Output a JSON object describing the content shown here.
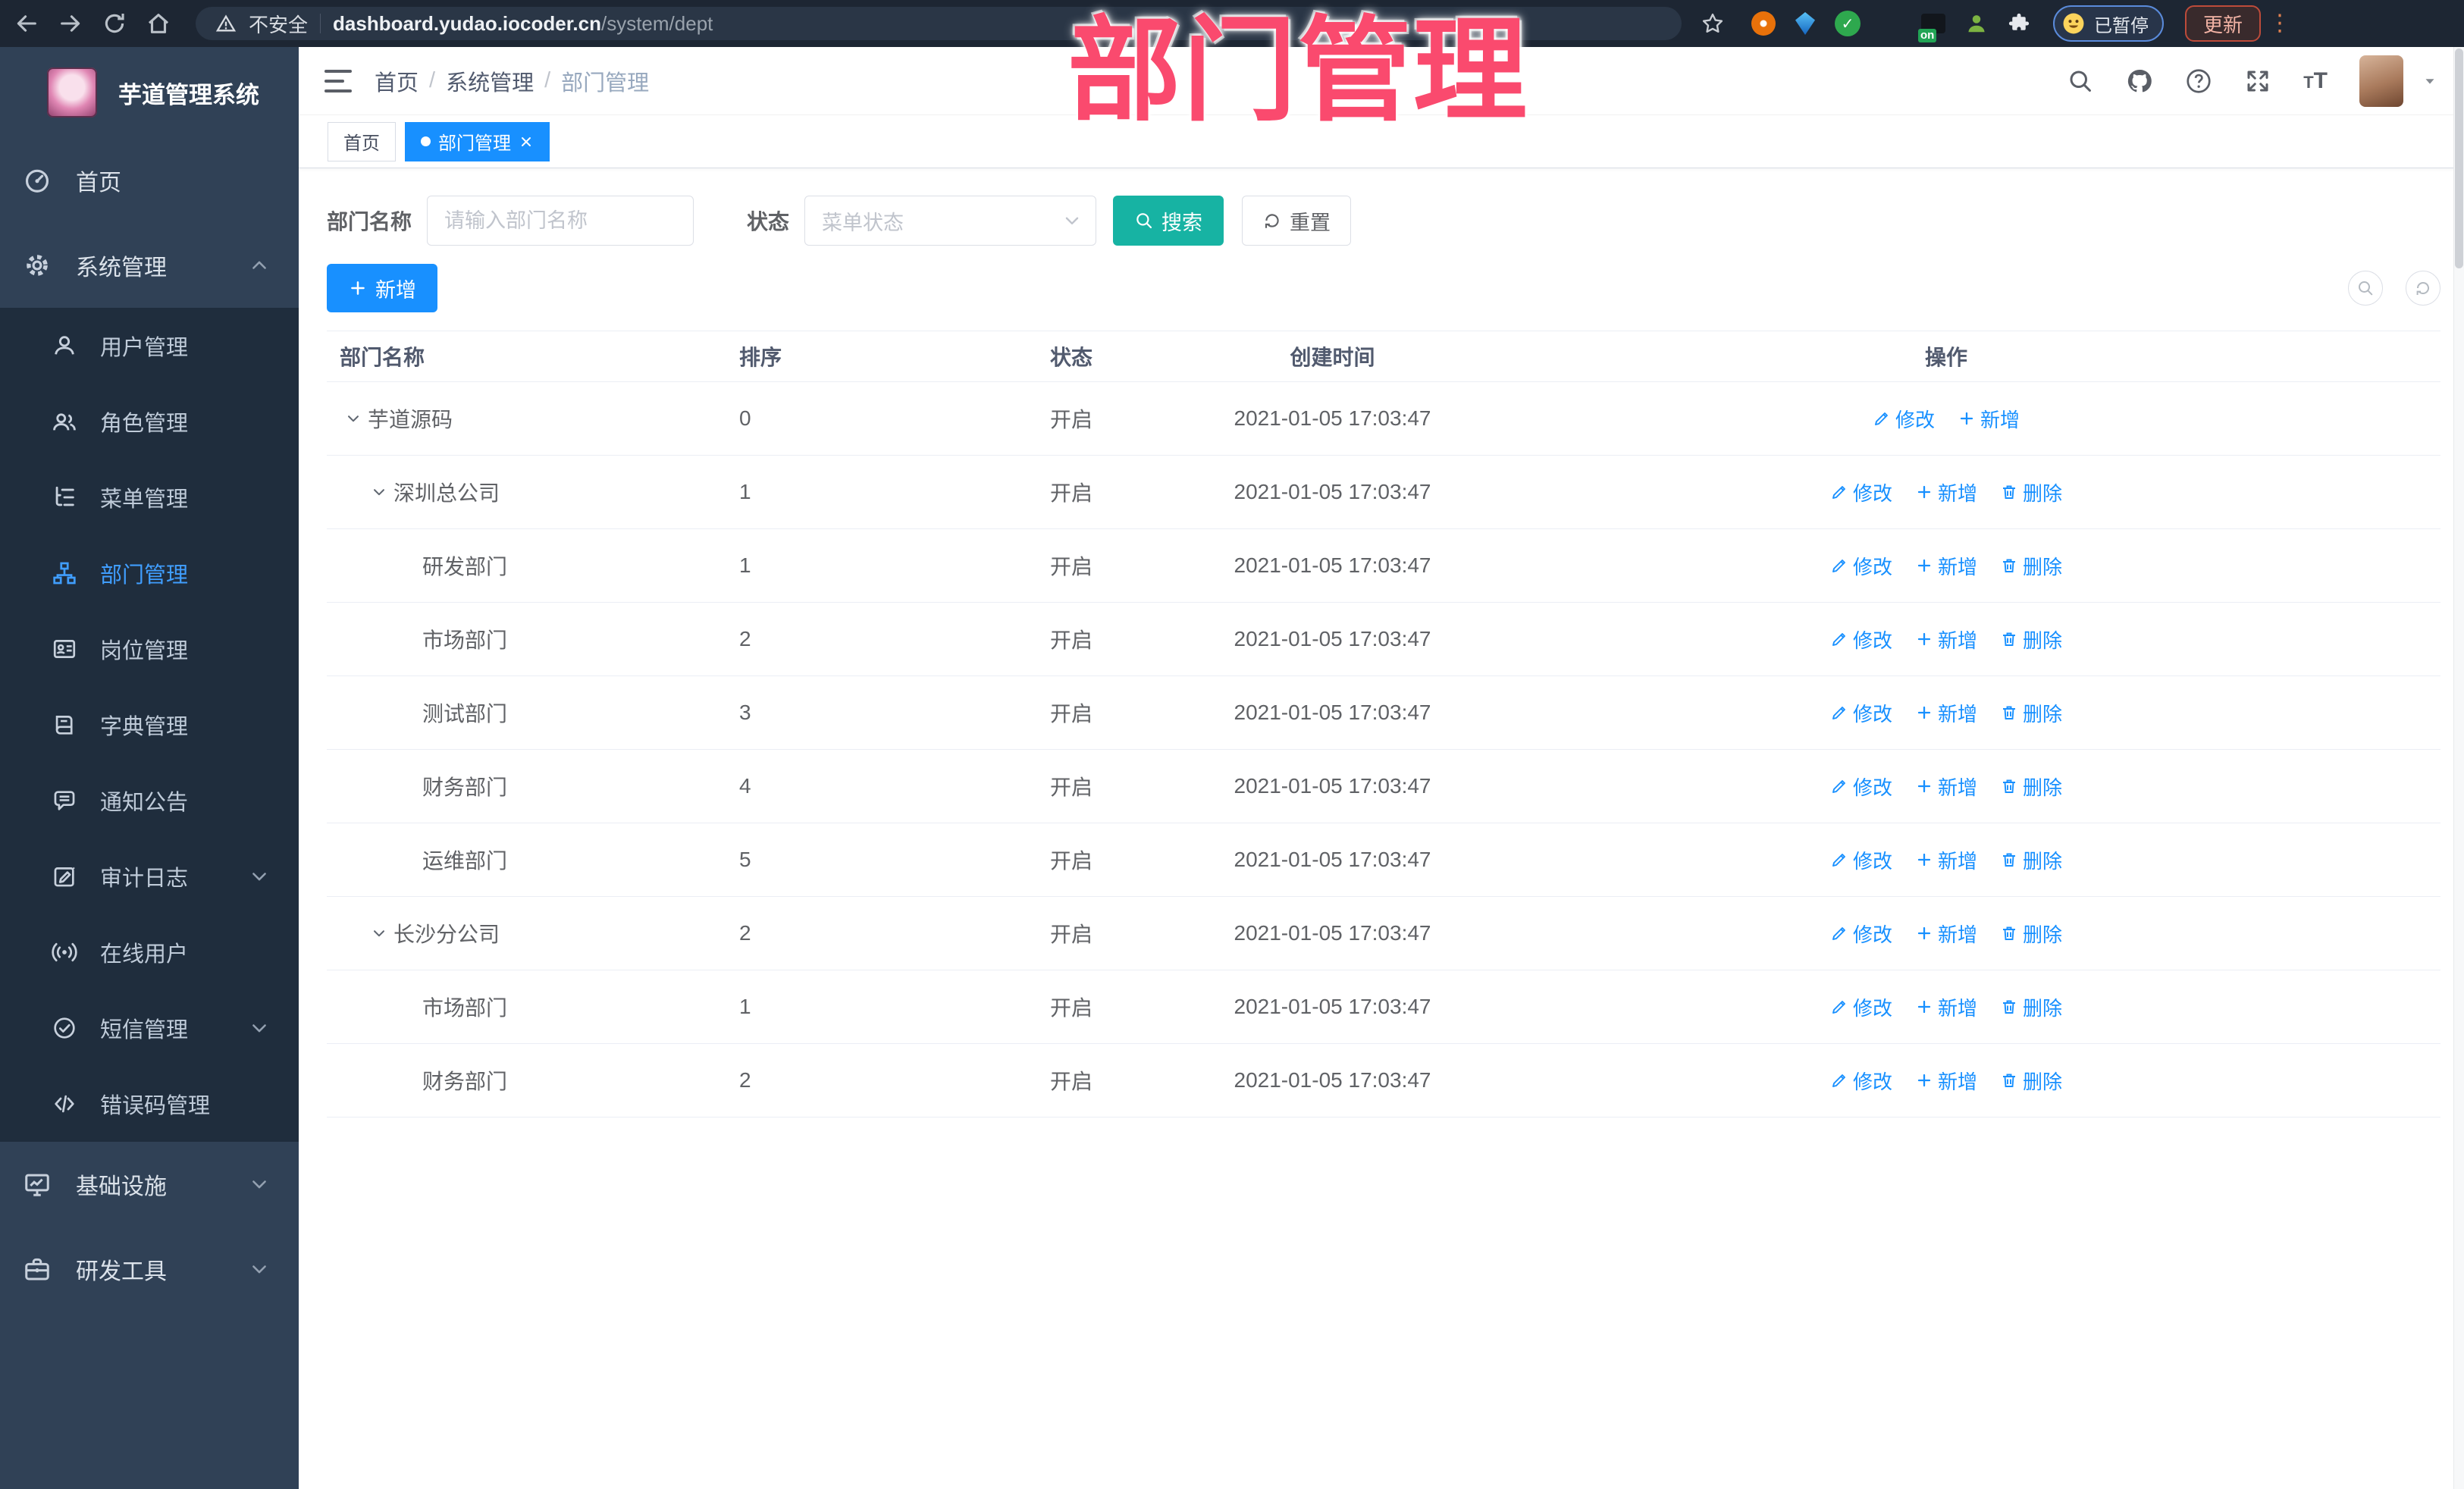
{
  "browser": {
    "security_label": "不安全",
    "url_domain": "dashboard.yudao.iocoder.cn",
    "url_path": "/system/dept",
    "extension_badge": "on",
    "profile_status": "已暂停",
    "update_label": "更新",
    "kebab": "⋮"
  },
  "overlay_title": "部门管理",
  "sidebar": {
    "app_title": "芋道管理系统",
    "items": [
      {
        "name": "home",
        "label": "首页",
        "icon": "dashboard",
        "level": 0
      },
      {
        "name": "system",
        "label": "系统管理",
        "icon": "gear",
        "level": 0,
        "chevron": "up"
      },
      {
        "name": "user-mgmt",
        "label": "用户管理",
        "icon": "user",
        "level": 1
      },
      {
        "name": "role-mgmt",
        "label": "角色管理",
        "icon": "users",
        "level": 1
      },
      {
        "name": "menu-mgmt",
        "label": "菜单管理",
        "icon": "tree",
        "level": 1
      },
      {
        "name": "dept-mgmt",
        "label": "部门管理",
        "icon": "org",
        "level": 1,
        "active": true
      },
      {
        "name": "post-mgmt",
        "label": "岗位管理",
        "icon": "badge",
        "level": 1
      },
      {
        "name": "dict-mgmt",
        "label": "字典管理",
        "icon": "book",
        "level": 1
      },
      {
        "name": "notice",
        "label": "通知公告",
        "icon": "bullhorn",
        "level": 1
      },
      {
        "name": "audit-log",
        "label": "审计日志",
        "icon": "log",
        "level": 1,
        "chevron": "down"
      },
      {
        "name": "online-user",
        "label": "在线用户",
        "icon": "online",
        "level": 1
      },
      {
        "name": "sms-mgmt",
        "label": "短信管理",
        "icon": "sms",
        "level": 1,
        "chevron": "down"
      },
      {
        "name": "error-code",
        "label": "错误码管理",
        "icon": "code",
        "level": 1
      },
      {
        "name": "infra",
        "label": "基础设施",
        "icon": "monitor",
        "level": 0,
        "chevron": "down"
      },
      {
        "name": "dev-tools",
        "label": "研发工具",
        "icon": "tool",
        "level": 0,
        "chevron": "down"
      }
    ]
  },
  "navbar": {
    "breadcrumb": [
      "首页",
      "系统管理",
      "部门管理"
    ]
  },
  "tabs": [
    {
      "label": "首页",
      "active": false
    },
    {
      "label": "部门管理",
      "active": true
    }
  ],
  "filters": {
    "name_label": "部门名称",
    "name_placeholder": "请输入部门名称",
    "status_label": "状态",
    "status_placeholder": "菜单状态",
    "search_label": "搜索",
    "reset_label": "重置"
  },
  "toolbar": {
    "add_label": "新增"
  },
  "table": {
    "headers": [
      "部门名称",
      "排序",
      "状态",
      "创建时间",
      "操作"
    ],
    "action_labels": {
      "edit": "修改",
      "add": "新增",
      "delete": "删除"
    },
    "rows": [
      {
        "name": "芋道源码",
        "level": 0,
        "expandable": true,
        "sort": "0",
        "status": "开启",
        "created": "2021-01-05 17:03:47",
        "actions": [
          "edit",
          "add"
        ]
      },
      {
        "name": "深圳总公司",
        "level": 1,
        "expandable": true,
        "sort": "1",
        "status": "开启",
        "created": "2021-01-05 17:03:47",
        "actions": [
          "edit",
          "add",
          "delete"
        ]
      },
      {
        "name": "研发部门",
        "level": 2,
        "expandable": false,
        "sort": "1",
        "status": "开启",
        "created": "2021-01-05 17:03:47",
        "actions": [
          "edit",
          "add",
          "delete"
        ]
      },
      {
        "name": "市场部门",
        "level": 2,
        "expandable": false,
        "sort": "2",
        "status": "开启",
        "created": "2021-01-05 17:03:47",
        "actions": [
          "edit",
          "add",
          "delete"
        ]
      },
      {
        "name": "测试部门",
        "level": 2,
        "expandable": false,
        "sort": "3",
        "status": "开启",
        "created": "2021-01-05 17:03:47",
        "actions": [
          "edit",
          "add",
          "delete"
        ]
      },
      {
        "name": "财务部门",
        "level": 2,
        "expandable": false,
        "sort": "4",
        "status": "开启",
        "created": "2021-01-05 17:03:47",
        "actions": [
          "edit",
          "add",
          "delete"
        ]
      },
      {
        "name": "运维部门",
        "level": 2,
        "expandable": false,
        "sort": "5",
        "status": "开启",
        "created": "2021-01-05 17:03:47",
        "actions": [
          "edit",
          "add",
          "delete"
        ]
      },
      {
        "name": "长沙分公司",
        "level": 1,
        "expandable": true,
        "sort": "2",
        "status": "开启",
        "created": "2021-01-05 17:03:47",
        "actions": [
          "edit",
          "add",
          "delete"
        ]
      },
      {
        "name": "市场部门",
        "level": 2,
        "expandable": false,
        "sort": "1",
        "status": "开启",
        "created": "2021-01-05 17:03:47",
        "actions": [
          "edit",
          "add",
          "delete"
        ]
      },
      {
        "name": "财务部门",
        "level": 2,
        "expandable": false,
        "sort": "2",
        "status": "开启",
        "created": "2021-01-05 17:03:47",
        "actions": [
          "edit",
          "add",
          "delete"
        ]
      }
    ]
  },
  "colors": {
    "accent": "#1890ff",
    "teal": "#17b3a3",
    "sidebar_bg": "#304156",
    "submenu_bg": "#1f2d3d",
    "active_menu": "#409eff",
    "overlay_pink": "#fa4a6e"
  }
}
